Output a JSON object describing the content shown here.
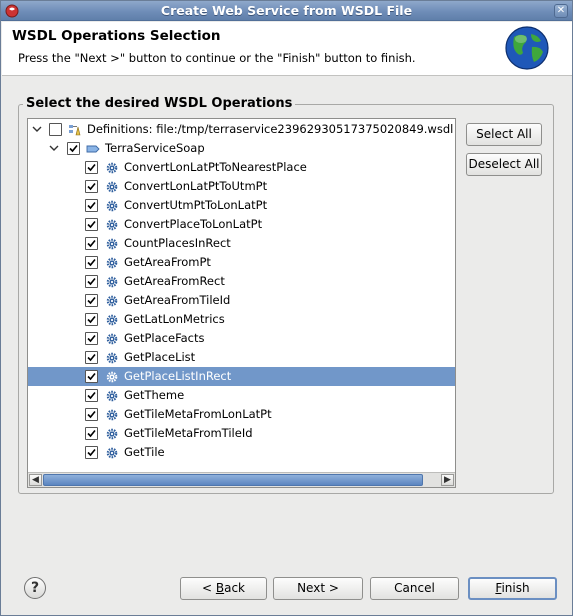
{
  "window": {
    "title": "Create Web Service from WSDL File"
  },
  "header": {
    "title": "WSDL Operations Selection",
    "description": "Press the \"Next >\" button to continue or the \"Finish\" button to finish."
  },
  "group": {
    "label": "Select the desired WSDL Operations"
  },
  "tree": {
    "root": {
      "label": "Definitions: file:/tmp/terraservice23962930517375020849.wsdl",
      "checked": false,
      "expanded": true
    },
    "service": {
      "label": "TerraServiceSoap",
      "checked": true,
      "expanded": true
    },
    "operations": [
      {
        "label": "ConvertLonLatPtToNearestPlace",
        "checked": true
      },
      {
        "label": "ConvertLonLatPtToUtmPt",
        "checked": true
      },
      {
        "label": "ConvertUtmPtToLonLatPt",
        "checked": true
      },
      {
        "label": "ConvertPlaceToLonLatPt",
        "checked": true
      },
      {
        "label": "CountPlacesInRect",
        "checked": true
      },
      {
        "label": "GetAreaFromPt",
        "checked": true
      },
      {
        "label": "GetAreaFromRect",
        "checked": true
      },
      {
        "label": "GetAreaFromTileId",
        "checked": true
      },
      {
        "label": "GetLatLonMetrics",
        "checked": true
      },
      {
        "label": "GetPlaceFacts",
        "checked": true
      },
      {
        "label": "GetPlaceList",
        "checked": true
      },
      {
        "label": "GetPlaceListInRect",
        "checked": true,
        "selected": true
      },
      {
        "label": "GetTheme",
        "checked": true
      },
      {
        "label": "GetTileMetaFromLonLatPt",
        "checked": true
      },
      {
        "label": "GetTileMetaFromTileId",
        "checked": true
      },
      {
        "label": "GetTile",
        "checked": true
      }
    ]
  },
  "side_buttons": {
    "select_all": "Select All",
    "deselect_all": "Deselect All"
  },
  "footer": {
    "help": "?",
    "back": "< Back",
    "next": "Next >",
    "cancel": "Cancel",
    "finish": "Finish"
  },
  "icons": {
    "app": "app-icon",
    "close": "close-icon",
    "globe": "globe-icon",
    "definitions": "wsdl-definitions-icon",
    "service": "port-type-icon",
    "operation": "operation-gear-icon"
  },
  "colors": {
    "selection": "#7197c9",
    "titlebar": "#6f8db8"
  }
}
